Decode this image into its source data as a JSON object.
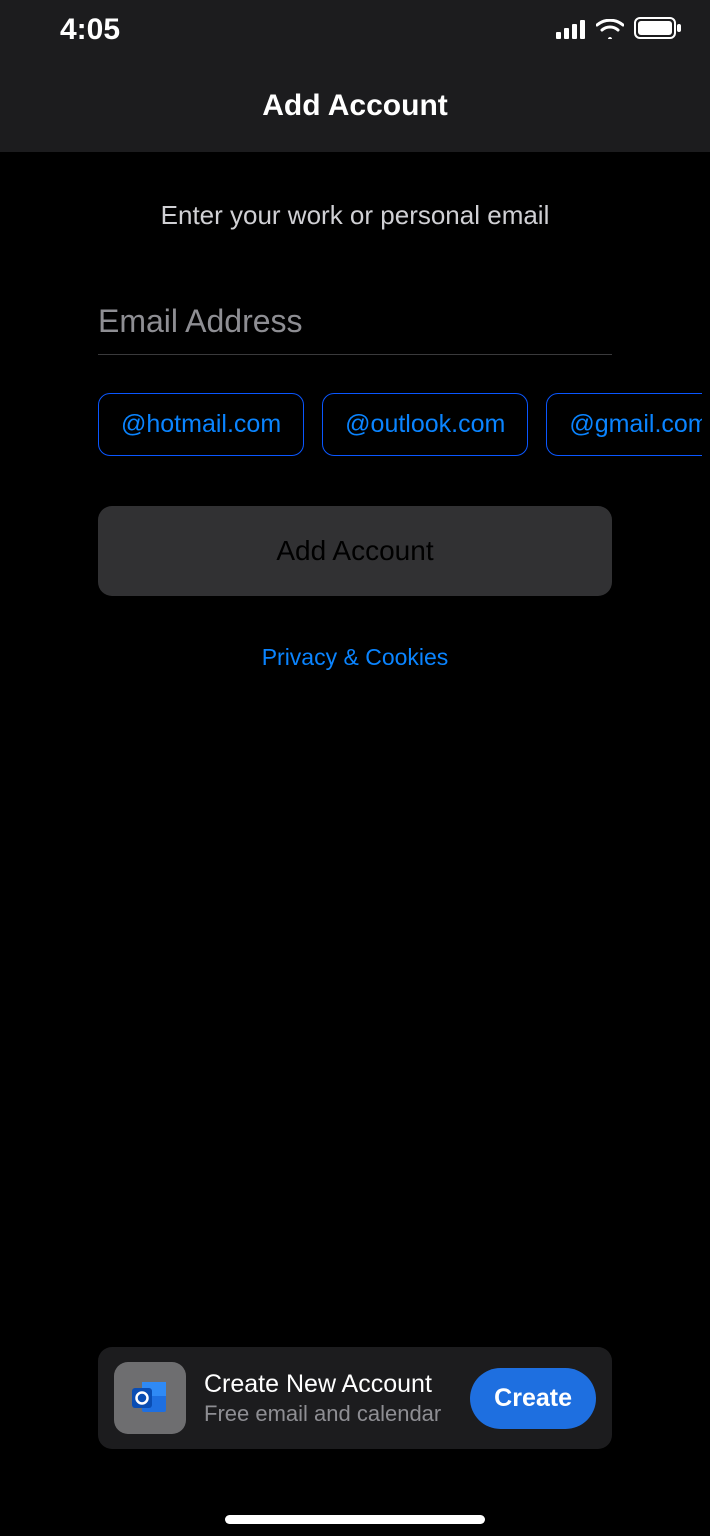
{
  "status": {
    "time": "4:05"
  },
  "header": {
    "title": "Add Account"
  },
  "form": {
    "prompt": "Enter your work or personal email",
    "email_placeholder": "Email Address",
    "email_value": "",
    "domain_suggestions": [
      "@hotmail.com",
      "@outlook.com",
      "@gmail.com"
    ],
    "submit_label": "Add Account",
    "privacy_label": "Privacy & Cookies"
  },
  "footer": {
    "title": "Create New Account",
    "subtitle": "Free email and calendar",
    "button_label": "Create",
    "icon_name": "outlook-icon"
  },
  "colors": {
    "accent_blue": "#0a84ff",
    "button_blue": "#1e6fe0",
    "header_bg": "#1c1c1e",
    "disabled_gray": "#3a3a3c"
  }
}
